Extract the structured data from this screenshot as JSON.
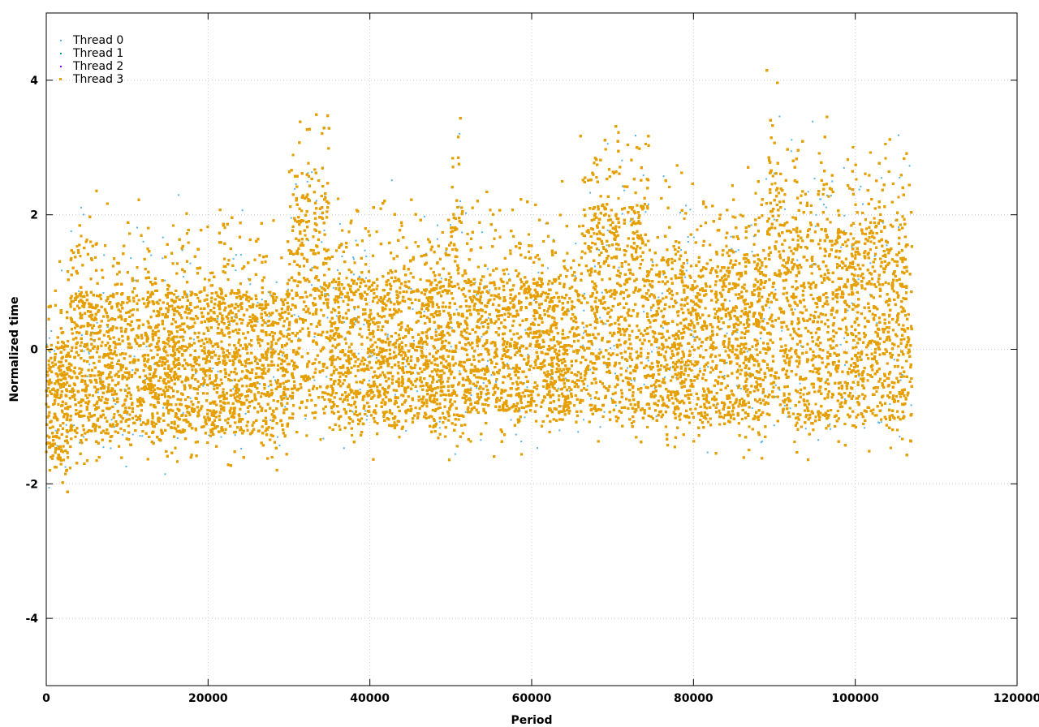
{
  "chart_data": {
    "type": "scatter",
    "title": "",
    "xlabel": "Period",
    "ylabel": "Normalized time",
    "xlim": [
      0,
      120000
    ],
    "ylim": [
      -5,
      5
    ],
    "xticks": [
      0,
      20000,
      40000,
      60000,
      80000,
      100000,
      120000
    ],
    "yticks": [
      -4,
      -2,
      0,
      2,
      4
    ],
    "grid": true,
    "legend_position": "top-left",
    "x_data_range": [
      0,
      107000
    ],
    "series": [
      {
        "name": "Thread 0",
        "color": "#56b4e9",
        "marker": "dot",
        "typical_y_range": [
          -1.8,
          3.0
        ]
      },
      {
        "name": "Thread 1",
        "color": "#009e73",
        "marker": "dot",
        "typical_y_range": [
          -1.8,
          3.0
        ]
      },
      {
        "name": "Thread 2",
        "color": "#9400d3",
        "marker": "dot",
        "typical_y_range": [
          -1.8,
          3.0
        ]
      },
      {
        "name": "Thread 3",
        "color": "#e69f00",
        "marker": "square",
        "typical_y_range": [
          -1.8,
          3.0
        ]
      }
    ],
    "dense_band_segments": [
      {
        "x": [
          0,
          3000
        ],
        "y": [
          -1.8,
          0.2
        ]
      },
      {
        "x": [
          3000,
          30000
        ],
        "y": [
          -1.4,
          1.0
        ]
      },
      {
        "x": [
          30500,
          35000
        ],
        "y": [
          -1.1,
          2.5
        ]
      },
      {
        "x": [
          35000,
          50000
        ],
        "y": [
          -1.2,
          1.2
        ]
      },
      {
        "x": [
          50000,
          51500
        ],
        "y": [
          -1.3,
          2.2
        ]
      },
      {
        "x": [
          51500,
          66000
        ],
        "y": [
          -1.1,
          1.2
        ]
      },
      {
        "x": [
          66000,
          74500
        ],
        "y": [
          -1.1,
          2.3
        ]
      },
      {
        "x": [
          74500,
          89000
        ],
        "y": [
          -1.2,
          1.5
        ]
      },
      {
        "x": [
          89000,
          91000
        ],
        "y": [
          -1.0,
          3.0
        ]
      },
      {
        "x": [
          91000,
          107000
        ],
        "y": [
          -1.2,
          2.0
        ]
      }
    ]
  }
}
